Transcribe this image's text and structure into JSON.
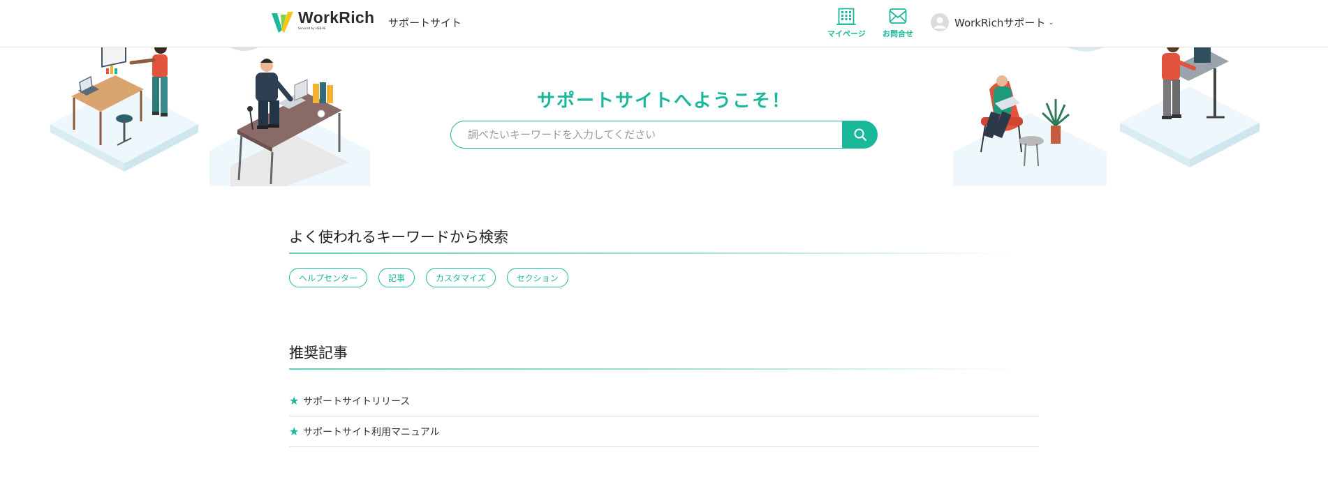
{
  "header": {
    "logo_name": "WorkRich",
    "logo_sub": "Serviced by HSB-AE",
    "site_label": "サポートサイト",
    "nav": [
      {
        "label": "マイページ",
        "icon": "building-icon"
      },
      {
        "label": "お問合せ",
        "icon": "mail-icon"
      }
    ],
    "user_name": "WorkRichサポート"
  },
  "hero": {
    "title": "サポートサイトへようこそ！",
    "search_placeholder": "調べたいキーワードを入力してください"
  },
  "keywords": {
    "title": "よく使われるキーワードから検索",
    "tags": [
      "ヘルプセンター",
      "記事",
      "カスタマイズ",
      "セクション"
    ]
  },
  "recommended": {
    "title": "推奨記事",
    "articles": [
      "サポートサイトリリース",
      "サポートサイト利用マニュアル"
    ]
  },
  "colors": {
    "accent": "#19b89b"
  }
}
